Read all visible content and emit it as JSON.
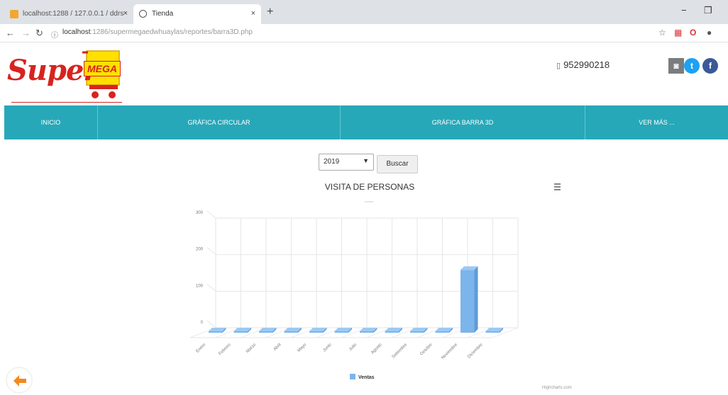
{
  "browser": {
    "tabs": [
      {
        "title": "localhost:1288 / 127.0.0.1 / ddrs",
        "close": "×"
      },
      {
        "title": "Tienda",
        "close": "×"
      }
    ],
    "new_tab": "+",
    "url_host": "localhost",
    "url_rest": ":1286/supermegaedwhuaylas/reportes/barra3D.php"
  },
  "header": {
    "logo_main": "Super",
    "logo_sub": "MEGA",
    "phone": "952990218"
  },
  "nav": {
    "items": [
      "INICIO",
      "GRÁFICA CIRCULAR",
      "GRÁFICA BARRA 3D",
      "VER MÁS ..."
    ]
  },
  "controls": {
    "year_value": "2019",
    "search_label": "Buscar"
  },
  "chart_data": {
    "type": "bar",
    "title": "VISITA DE PERSONAS",
    "subtitle": "",
    "xlabel": "",
    "ylabel": "",
    "categories": [
      "Enero",
      "Febrero",
      "Marzo",
      "Abril",
      "Mayo",
      "Junio",
      "Julio",
      "Agosto",
      "Setiembre",
      "Octubre",
      "Noviembre",
      "Diciembre"
    ],
    "series": [
      {
        "name": "Ventas",
        "values": [
          0,
          0,
          0,
          0,
          0,
          0,
          0,
          0,
          0,
          0,
          168,
          0
        ],
        "color": "#7cb5ec"
      }
    ],
    "ylim": [
      0,
      300
    ],
    "yticks": [
      0,
      100,
      200,
      300
    ],
    "grid": true,
    "legend": "bottom",
    "three_d": true,
    "credits": "Highcharts.com"
  }
}
